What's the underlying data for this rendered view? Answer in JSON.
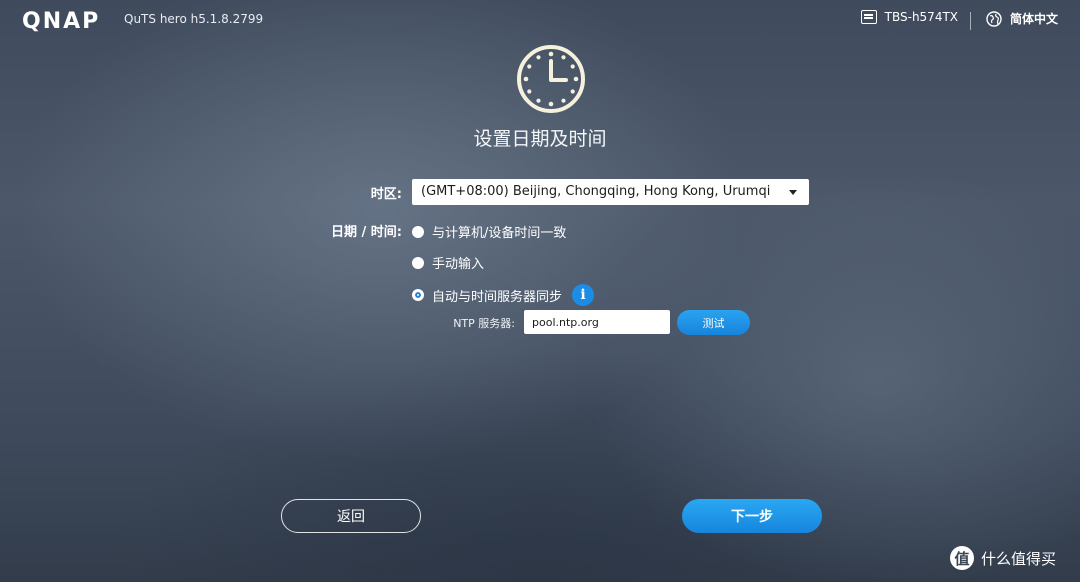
{
  "header": {
    "logo_text": "QNAP",
    "version": "QuTS hero h5.1.8.2799",
    "device_name": "TBS-h574TX",
    "language": "简体中文"
  },
  "page": {
    "title": "设置日期及时间"
  },
  "form": {
    "timezone_label": "时区:",
    "timezone_value": "(GMT+08:00) Beijing, Chongqing, Hong Kong, Urumqi",
    "datetime_label": "日期 / 时间:",
    "options": [
      {
        "label": "与计算机/设备时间一致",
        "selected": false
      },
      {
        "label": "手动输入",
        "selected": false
      },
      {
        "label": "自动与时间服务器同步",
        "selected": true
      }
    ],
    "ntp_label": "NTP 服务器:",
    "ntp_value": "pool.ntp.org",
    "test_label": "测试",
    "info_icon_text": "i"
  },
  "footer": {
    "back_label": "返回",
    "next_label": "下一步"
  },
  "watermark": {
    "logo_char": "值",
    "text": "什么值得买"
  },
  "colors": {
    "accent": "#1c8de6",
    "button_blue": "#1f95e6",
    "text": "#ffffff"
  },
  "icons": {
    "device": "nas-device-icon",
    "language": "globe-icon",
    "clock": "clock-icon",
    "info": "info-icon",
    "dropdown": "caret-down-icon"
  }
}
